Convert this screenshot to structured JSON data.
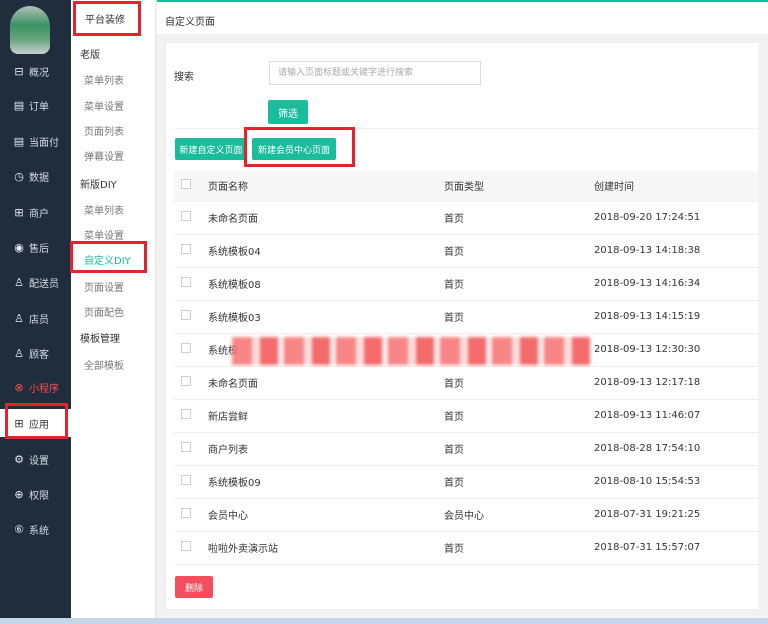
{
  "sidebar": {
    "items": [
      {
        "icon": "overview-icon",
        "glyph": "⊟",
        "label": "概况"
      },
      {
        "icon": "order-icon",
        "glyph": "▤",
        "label": "订单"
      },
      {
        "icon": "face-pay-icon",
        "glyph": "▤",
        "label": "当面付"
      },
      {
        "icon": "data-icon",
        "glyph": "◷",
        "label": "数据"
      },
      {
        "icon": "merchant-icon",
        "glyph": "⊞",
        "label": "商户"
      },
      {
        "icon": "after-sale-icon",
        "glyph": "◉",
        "label": "售后"
      },
      {
        "icon": "courier-icon",
        "glyph": "♙",
        "label": "配送员"
      },
      {
        "icon": "clerk-icon",
        "glyph": "♙",
        "label": "店员"
      },
      {
        "icon": "customer-icon",
        "glyph": "♙",
        "label": "顾客"
      },
      {
        "icon": "mini-program-icon",
        "glyph": "⊗",
        "label": "小程序"
      },
      {
        "icon": "app-icon",
        "glyph": "⊞",
        "label": "应用"
      },
      {
        "icon": "settings-icon",
        "glyph": "⚙",
        "label": "设置"
      },
      {
        "icon": "permission-icon",
        "glyph": "⊕",
        "label": "权限"
      },
      {
        "icon": "system-icon",
        "glyph": "⑥",
        "label": "系统"
      }
    ]
  },
  "subnav": {
    "header": "平台装修",
    "old_group": "老版",
    "old_links": [
      "菜单列表",
      "菜单设置",
      "页面列表",
      "弹幕设置"
    ],
    "new_group": "新版DIY",
    "new_links": [
      "菜单列表",
      "菜单设置",
      "自定义DIY",
      "页面设置",
      "页面配色"
    ],
    "template_group": "模板管理",
    "template_links": [
      "全部模板"
    ]
  },
  "header": {
    "title": "自定义页面"
  },
  "search": {
    "label": "搜索",
    "placeholder": "请输入页面标题或关键字进行搜索",
    "filter_label": "筛选"
  },
  "actions": {
    "new_custom": "新建自定义页面",
    "new_member": "新建会员中心页面",
    "delete": "删除"
  },
  "table": {
    "headers": [
      "页面名称",
      "页面类型",
      "创建时间"
    ],
    "rows": [
      {
        "name": "未命名页面",
        "type": "首页",
        "time": "2018-09-20 17:24:51"
      },
      {
        "name": "系统模板04",
        "type": "首页",
        "time": "2018-09-13 14:18:38"
      },
      {
        "name": "系统模板08",
        "type": "首页",
        "time": "2018-09-13 14:16:34"
      },
      {
        "name": "系统模板03",
        "type": "首页",
        "time": "2018-09-13 14:15:19"
      },
      {
        "name": "系统模",
        "type": "",
        "time": "2018-09-13 12:30:30"
      },
      {
        "name": "未命名页面",
        "type": "首页",
        "time": "2018-09-13 12:17:18"
      },
      {
        "name": "新店尝鲜",
        "type": "首页",
        "time": "2018-09-13 11:46:07"
      },
      {
        "name": "商户列表",
        "type": "首页",
        "time": "2018-08-28 17:54:10"
      },
      {
        "name": "系统模板09",
        "type": "首页",
        "time": "2018-08-10 15:54:53"
      },
      {
        "name": "会员中心",
        "type": "会员中心",
        "time": "2018-07-31 19:21:25"
      },
      {
        "name": "啦啦外卖演示站",
        "type": "首页",
        "time": "2018-07-31 15:57:07"
      }
    ]
  },
  "colors": {
    "accent": "#1abc9c",
    "danger": "#f44e5e",
    "annotation": "#e8212f",
    "sidebar": "#1f2d3d"
  }
}
